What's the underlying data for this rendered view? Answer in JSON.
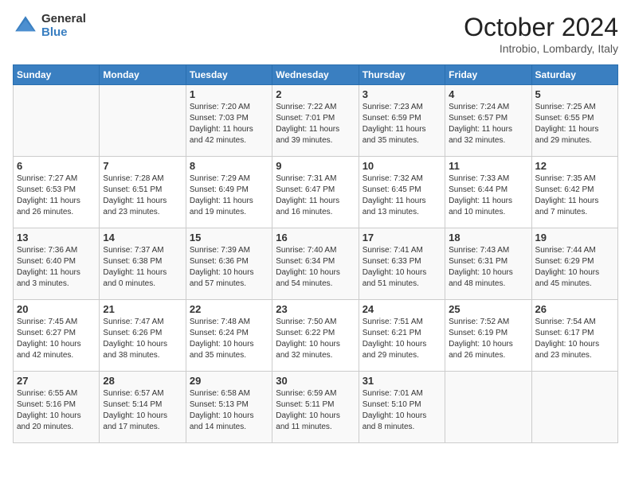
{
  "header": {
    "logo_general": "General",
    "logo_blue": "Blue",
    "month_title": "October 2024",
    "location": "Introbio, Lombardy, Italy"
  },
  "weekdays": [
    "Sunday",
    "Monday",
    "Tuesday",
    "Wednesday",
    "Thursday",
    "Friday",
    "Saturday"
  ],
  "weeks": [
    [
      {
        "day": "",
        "info": ""
      },
      {
        "day": "",
        "info": ""
      },
      {
        "day": "1",
        "info": "Sunrise: 7:20 AM\nSunset: 7:03 PM\nDaylight: 11 hours\nand 42 minutes."
      },
      {
        "day": "2",
        "info": "Sunrise: 7:22 AM\nSunset: 7:01 PM\nDaylight: 11 hours\nand 39 minutes."
      },
      {
        "day": "3",
        "info": "Sunrise: 7:23 AM\nSunset: 6:59 PM\nDaylight: 11 hours\nand 35 minutes."
      },
      {
        "day": "4",
        "info": "Sunrise: 7:24 AM\nSunset: 6:57 PM\nDaylight: 11 hours\nand 32 minutes."
      },
      {
        "day": "5",
        "info": "Sunrise: 7:25 AM\nSunset: 6:55 PM\nDaylight: 11 hours\nand 29 minutes."
      }
    ],
    [
      {
        "day": "6",
        "info": "Sunrise: 7:27 AM\nSunset: 6:53 PM\nDaylight: 11 hours\nand 26 minutes."
      },
      {
        "day": "7",
        "info": "Sunrise: 7:28 AM\nSunset: 6:51 PM\nDaylight: 11 hours\nand 23 minutes."
      },
      {
        "day": "8",
        "info": "Sunrise: 7:29 AM\nSunset: 6:49 PM\nDaylight: 11 hours\nand 19 minutes."
      },
      {
        "day": "9",
        "info": "Sunrise: 7:31 AM\nSunset: 6:47 PM\nDaylight: 11 hours\nand 16 minutes."
      },
      {
        "day": "10",
        "info": "Sunrise: 7:32 AM\nSunset: 6:45 PM\nDaylight: 11 hours\nand 13 minutes."
      },
      {
        "day": "11",
        "info": "Sunrise: 7:33 AM\nSunset: 6:44 PM\nDaylight: 11 hours\nand 10 minutes."
      },
      {
        "day": "12",
        "info": "Sunrise: 7:35 AM\nSunset: 6:42 PM\nDaylight: 11 hours\nand 7 minutes."
      }
    ],
    [
      {
        "day": "13",
        "info": "Sunrise: 7:36 AM\nSunset: 6:40 PM\nDaylight: 11 hours\nand 3 minutes."
      },
      {
        "day": "14",
        "info": "Sunrise: 7:37 AM\nSunset: 6:38 PM\nDaylight: 11 hours\nand 0 minutes."
      },
      {
        "day": "15",
        "info": "Sunrise: 7:39 AM\nSunset: 6:36 PM\nDaylight: 10 hours\nand 57 minutes."
      },
      {
        "day": "16",
        "info": "Sunrise: 7:40 AM\nSunset: 6:34 PM\nDaylight: 10 hours\nand 54 minutes."
      },
      {
        "day": "17",
        "info": "Sunrise: 7:41 AM\nSunset: 6:33 PM\nDaylight: 10 hours\nand 51 minutes."
      },
      {
        "day": "18",
        "info": "Sunrise: 7:43 AM\nSunset: 6:31 PM\nDaylight: 10 hours\nand 48 minutes."
      },
      {
        "day": "19",
        "info": "Sunrise: 7:44 AM\nSunset: 6:29 PM\nDaylight: 10 hours\nand 45 minutes."
      }
    ],
    [
      {
        "day": "20",
        "info": "Sunrise: 7:45 AM\nSunset: 6:27 PM\nDaylight: 10 hours\nand 42 minutes."
      },
      {
        "day": "21",
        "info": "Sunrise: 7:47 AM\nSunset: 6:26 PM\nDaylight: 10 hours\nand 38 minutes."
      },
      {
        "day": "22",
        "info": "Sunrise: 7:48 AM\nSunset: 6:24 PM\nDaylight: 10 hours\nand 35 minutes."
      },
      {
        "day": "23",
        "info": "Sunrise: 7:50 AM\nSunset: 6:22 PM\nDaylight: 10 hours\nand 32 minutes."
      },
      {
        "day": "24",
        "info": "Sunrise: 7:51 AM\nSunset: 6:21 PM\nDaylight: 10 hours\nand 29 minutes."
      },
      {
        "day": "25",
        "info": "Sunrise: 7:52 AM\nSunset: 6:19 PM\nDaylight: 10 hours\nand 26 minutes."
      },
      {
        "day": "26",
        "info": "Sunrise: 7:54 AM\nSunset: 6:17 PM\nDaylight: 10 hours\nand 23 minutes."
      }
    ],
    [
      {
        "day": "27",
        "info": "Sunrise: 6:55 AM\nSunset: 5:16 PM\nDaylight: 10 hours\nand 20 minutes."
      },
      {
        "day": "28",
        "info": "Sunrise: 6:57 AM\nSunset: 5:14 PM\nDaylight: 10 hours\nand 17 minutes."
      },
      {
        "day": "29",
        "info": "Sunrise: 6:58 AM\nSunset: 5:13 PM\nDaylight: 10 hours\nand 14 minutes."
      },
      {
        "day": "30",
        "info": "Sunrise: 6:59 AM\nSunset: 5:11 PM\nDaylight: 10 hours\nand 11 minutes."
      },
      {
        "day": "31",
        "info": "Sunrise: 7:01 AM\nSunset: 5:10 PM\nDaylight: 10 hours\nand 8 minutes."
      },
      {
        "day": "",
        "info": ""
      },
      {
        "day": "",
        "info": ""
      }
    ]
  ]
}
